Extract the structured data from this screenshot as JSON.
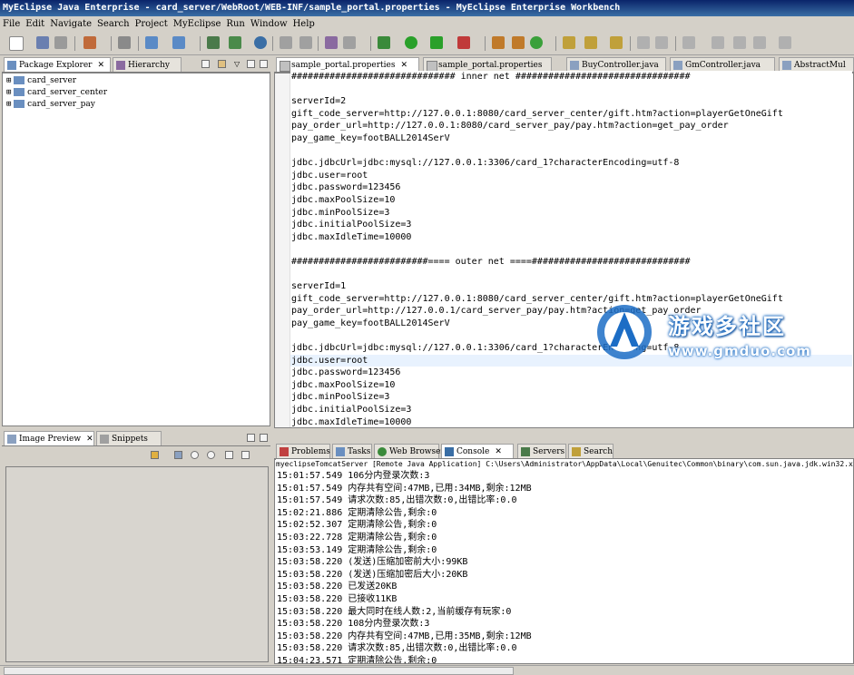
{
  "window": {
    "title": "MyEclipse Java Enterprise - card_server/WebRoot/WEB-INF/sample_portal.properties - MyEclipse Enterprise Workbench"
  },
  "menu": [
    "File",
    "Edit",
    "Navigate",
    "Search",
    "Project",
    "MyEclipse",
    "Run",
    "Window",
    "Help"
  ],
  "left_panel": {
    "tabs": [
      "Package Explorer",
      "Hierarchy"
    ],
    "projects": [
      "card_server",
      "card_server_center",
      "card_server_pay"
    ]
  },
  "preview_panel": {
    "tabs": [
      "Image Preview",
      "Snippets"
    ]
  },
  "editor": {
    "tabs": [
      "sample_portal.properties",
      "sample_portal.properties",
      "BuyController.java",
      "GmController.java",
      "AbstractMul"
    ],
    "lines": [
      "############################## inner net ################################",
      "",
      "serverId=2",
      "gift_code_server=http://127.0.0.1:8080/card_server_center/gift.htm?action=playerGetOneGift",
      "pay_order_url=http://127.0.0.1:8080/card_server_pay/pay.htm?action=get_pay_order",
      "pay_game_key=footBALL2014SerV",
      "",
      "jdbc.jdbcUrl=jdbc:mysql://127.0.0.1:3306/card_1?characterEncoding=utf-8",
      "jdbc.user=root",
      "jdbc.password=123456",
      "jdbc.maxPoolSize=10",
      "jdbc.minPoolSize=3",
      "jdbc.initialPoolSize=3",
      "jdbc.maxIdleTime=10000",
      "",
      "#########################==== outer net ====#############################",
      "",
      "serverId=1",
      "gift_code_server=http://127.0.0.1:8080/card_server_center/gift.htm?action=playerGetOneGift",
      "pay_order_url=http://127.0.0.1/card_server_pay/pay.htm?action=get_pay_order",
      "pay_game_key=footBALL2014SerV",
      "",
      "jdbc.jdbcUrl=jdbc:mysql://127.0.0.1:3306/card_1?characterEncoding=utf-8",
      "jdbc.user=root",
      "jdbc.password=123456",
      "jdbc.maxPoolSize=10",
      "jdbc.minPoolSize=3",
      "jdbc.initialPoolSize=3",
      "jdbc.maxIdleTime=10000"
    ]
  },
  "bottom_panel": {
    "tabs": [
      "Problems",
      "Tasks",
      "Web Browser",
      "Console",
      "Servers",
      "Search"
    ],
    "console_header": "myeclipseTomcatServer [Remote Java Application] C:\\Users\\Administrator\\AppData\\Local\\Genuitec\\Common\\binary\\com.sun.java.jdk.win32.x8",
    "console_lines": [
      "15:01:57.549 106分内登录次数:3",
      "15:01:57.549 内存共有空间:47MB,已用:34MB,剩余:12MB",
      "15:01:57.549 请求次数:85,出错次数:0,出错比率:0.0",
      "15:02:21.886 定期清除公告,剩余:0",
      "15:02:52.307 定期清除公告,剩余:0",
      "15:03:22.728 定期清除公告,剩余:0",
      "15:03:53.149 定期清除公告,剩余:0",
      "15:03:58.220 (发送)压缩加密前大小:99KB",
      "15:03:58.220 (发送)压缩加密后大小:20KB",
      "15:03:58.220 已发送20KB",
      "15:03:58.220 已接收11KB",
      "15:03:58.220 最大同时在线人数:2,当前缓存有玩家:0",
      "15:03:58.220 108分内登录次数:3",
      "15:03:58.220 内存共有空间:47MB,已用:35MB,剩余:12MB",
      "15:03:58.220 请求次数:85,出错次数:0,出错比率:0.0",
      "15:04:23.571 定期清除公告,剩余:0"
    ]
  },
  "watermark": {
    "title": "游戏多社区",
    "url": "www.gmduo.com"
  },
  "colors": {
    "titlebar": "#0a246a",
    "accent": "#3a6ea5",
    "watermark_blue": "#1c6dc5"
  }
}
